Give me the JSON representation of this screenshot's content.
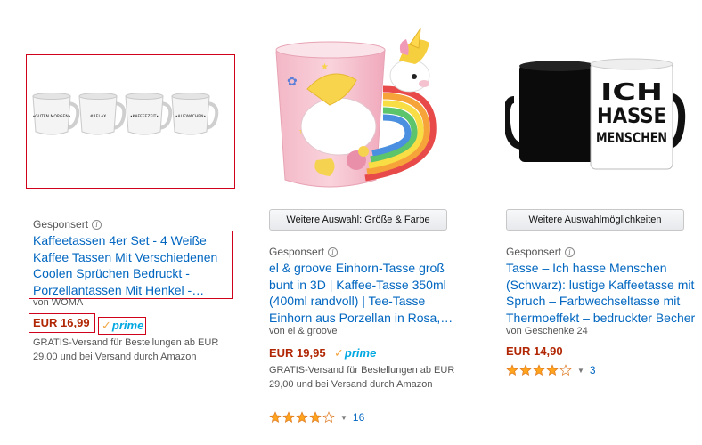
{
  "products": [
    {
      "sponsored_label": "Gesponsert",
      "title": "Kaffeetassen 4er Set - 4 Weiße Kaffee Tassen Mit Verschiedenen Coolen Sprüchen Bedruckt - Porzellantassen Mit Henkel - Spülmaschinengeeignet",
      "byline": "von WOMA",
      "price": "EUR 16,99",
      "prime_label": "prime",
      "shipping": "GRATIS-Versand für Bestellungen ab EUR 29,00 und bei Versand durch Amazon",
      "mug_labels": [
        "•GUTEN MORGEN•",
        "#RELAX",
        "•KAFFEEZEIT•",
        "•AUFWACHEN•"
      ]
    },
    {
      "options_button": "Weitere Auswahl: Größe & Farbe",
      "sponsored_label": "Gesponsert",
      "title": "el & groove Einhorn-Tasse groß bunt in 3D | Kaffee-Tasse 350ml (400ml randvoll) | Tee-Tasse Einhorn aus Porzellan in Rosa, Geschenk für Mädchen",
      "byline": "von el & groove",
      "price": "EUR 19,95",
      "prime_label": "prime",
      "shipping": "GRATIS-Versand für Bestellungen ab EUR 29,00 und bei Versand durch Amazon",
      "rating": 4,
      "rating_count": "16"
    },
    {
      "options_button": "Weitere Auswahlmöglichkeiten",
      "sponsored_label": "Gesponsert",
      "title": "Tasse – Ich hasse Menschen (Schwarz): lustige Kaffeetasse mit Spruch – Farbwechseltasse mit Thermoeffekt – bedruckter Becher",
      "byline": "von Geschenke 24",
      "price": "EUR 14,90",
      "rating": 4,
      "rating_count": "3",
      "mug_text": [
        "ICH",
        "HASSE",
        "MENSCHEN"
      ]
    }
  ],
  "colors": {
    "link": "#0066c0",
    "price": "#b12704",
    "prime": "#00a8e1",
    "star": "#ffa41c",
    "annotation": "#d0021b"
  }
}
